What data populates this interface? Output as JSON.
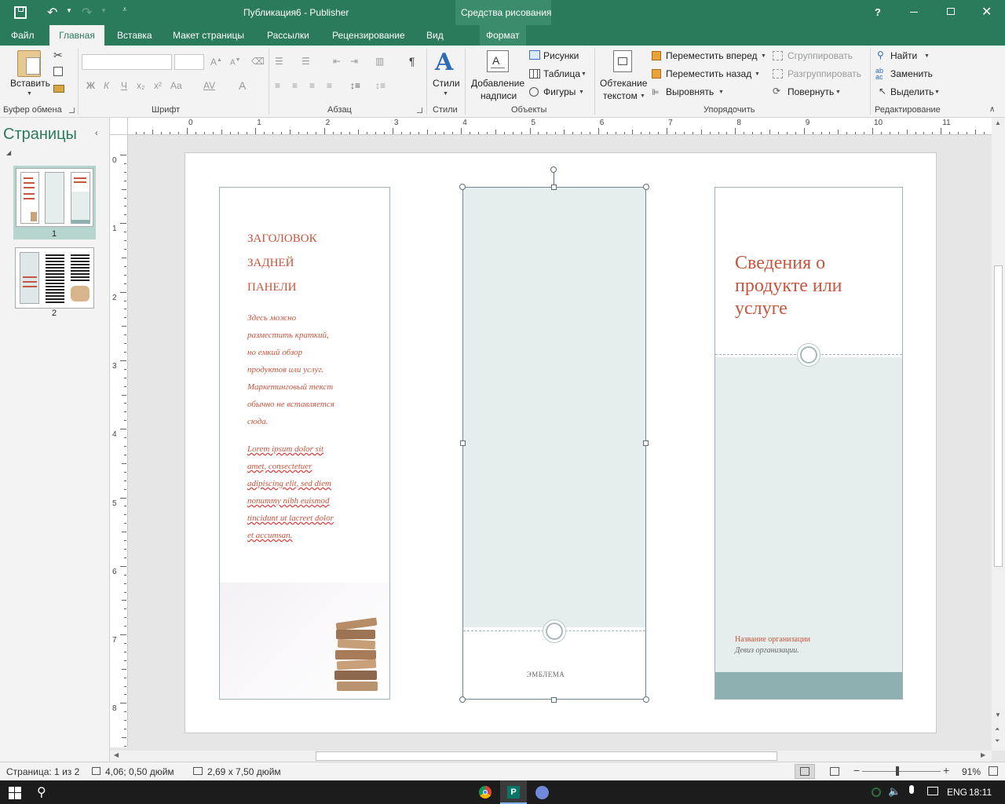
{
  "titlebar": {
    "title": "Публикация6 - Publisher",
    "context_tab_group": "Средства рисования",
    "help": "?"
  },
  "menu": {
    "tabs": [
      "Файл",
      "Главная",
      "Вставка",
      "Макет страницы",
      "Рассылки",
      "Рецензирование",
      "Вид"
    ],
    "active": "Главная",
    "context_tab": "Формат"
  },
  "ribbon": {
    "clipboard": {
      "paste": "Вставить",
      "label": "Буфер обмена"
    },
    "font": {
      "label": "Шрифт",
      "bold": "Ж",
      "italic": "К",
      "underline": "Ч",
      "sub": "x₂",
      "sup": "x²",
      "case": "Aa",
      "spacing": "AV",
      "color": "A"
    },
    "paragraph": {
      "label": "Абзац",
      "pilcrow": "¶"
    },
    "styles": {
      "button": "Стили",
      "label": "Стили"
    },
    "objects": {
      "label": "Объекты",
      "text_box_1": "Добавление",
      "text_box_2": "надписи",
      "pictures": "Рисунки",
      "table": "Таблица",
      "shapes": "Фигуры"
    },
    "arrange": {
      "label": "Упорядочить",
      "wrap_1": "Обтекание",
      "wrap_2": "текстом",
      "bring_forward": "Переместить вперед",
      "send_backward": "Переместить назад",
      "align": "Выровнять",
      "group": "Сгруппировать",
      "ungroup": "Разгруппировать",
      "rotate": "Повернуть"
    },
    "editing": {
      "label": "Редактирование",
      "find": "Найти",
      "replace": "Заменить",
      "select": "Выделить"
    }
  },
  "pages_pane": {
    "title": "Страницы",
    "pages": [
      {
        "number": "1",
        "selected": true
      },
      {
        "number": "2",
        "selected": false
      }
    ]
  },
  "ruler": {
    "h_ticks": [
      "0",
      "1",
      "2",
      "3",
      "4",
      "5",
      "6",
      "7",
      "8",
      "9",
      "10",
      "11"
    ],
    "v_ticks": [
      "0",
      "1",
      "2",
      "3",
      "4",
      "5",
      "6",
      "7",
      "8"
    ]
  },
  "document": {
    "left_panel": {
      "heading_lines": [
        "ЗАГОЛОВОК",
        "ЗАДНЕЙ",
        "ПАНЕЛИ"
      ],
      "body_lines": [
        "Здесь можно",
        "разместить краткий,",
        "но емкий обзор",
        "продуктов или услуг.",
        "Маркетинговый текст",
        "обычно не вставляется",
        "сюда."
      ],
      "lorem_lines": [
        "Lorem ipsum dolor sit",
        "amet, consectetuer",
        "adipiscing elit, sed diem",
        "nonummy nibh euismod",
        "tincidunt ut lacreet dolor",
        "et accumsan."
      ]
    },
    "middle_panel": {
      "emblem": "ЭМБЛЕМА"
    },
    "right_panel": {
      "title_lines": [
        "Сведения о",
        "продукте или",
        "услуге"
      ],
      "org_name": "Название организации",
      "org_motto": "Девиз организации."
    },
    "colors": {
      "accent": "#c8553d",
      "panel_fill": "#e6eeed",
      "footer_fill": "#8fb0b0",
      "border": "#9fb3b8"
    }
  },
  "statusbar": {
    "page": "Страница: 1 из 2",
    "position": "4,06; 0,50 дюйм",
    "size": "2,69 x  7,50 дюйм",
    "zoom": "91%"
  },
  "taskbar": {
    "lang": "ENG",
    "time": "18:11"
  }
}
